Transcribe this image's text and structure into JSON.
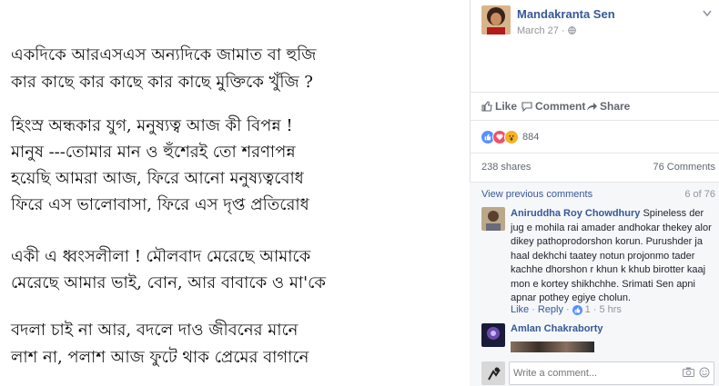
{
  "poem": {
    "lines": [
      "একদিকে আরএসএস অন্যদিকে জামাত বা হুজি",
      "কার কাছে কার কাছে কার কাছে মুক্তিকে খুঁজি ?",
      "হিংস্র অন্ধকার যুগ, মনুষ্যত্ব আজ কী বিপন্ন !",
      "মানুষ ---তোমার মান ও হুঁশেরই তো শরণাপন্ন",
      "হয়েছি আমরা আজ, ফিরে আনো মনুষ্যত্ববোধ",
      "ফিরে এস ভালোবাসা, ফিরে এস দৃপ্ত প্রতিরোধ",
      "একী এ ধ্বংসলীলা ! মৌলবাদ মেরেছে আমাকে",
      "মেরেছে আমার ভাই, বোন, আর বাবাকে ও মা'কে",
      "বদলা চাই না আর, বদলে দাও জীবনের মানে",
      "লাশ না, পলাশ আজ ফুটে থাক প্রেমের বাগানে"
    ]
  },
  "post": {
    "author": "Mandakranta Sen",
    "date": "March 27",
    "privacy_dot": "·"
  },
  "actions": {
    "like": "Like",
    "comment": "Comment",
    "share": "Share"
  },
  "reactions": {
    "count": "884",
    "colors": {
      "like": "#5890ff",
      "love": "#f25268",
      "wow": "#f7b125"
    }
  },
  "stats": {
    "shares": "238 shares",
    "comments": "76 Comments"
  },
  "comments": {
    "view_previous": "View previous comments",
    "pager": "6 of 76",
    "items": [
      {
        "name": "Aniruddha Roy Chowdhury",
        "text": "Spineless der jug e mohila rai amader andhokar thekey alor dikey pathoprodorshon korun. Purushder ja haal dekhchi taatey notun projonmo tader kachhe dhorshon r khun k khub birotter kaaj mon e kortey shikhchhe. Srimati Sen apni apnar pothey egiye cholun.",
        "like_label": "Like",
        "sep": "·",
        "reply_label": "Reply",
        "likes": "1",
        "time": "5 hrs"
      },
      {
        "name": "Amlan Chakraborty"
      }
    ],
    "compose_placeholder": "Write a comment..."
  },
  "theme": {
    "link": "#365899",
    "muted": "#90949c"
  }
}
